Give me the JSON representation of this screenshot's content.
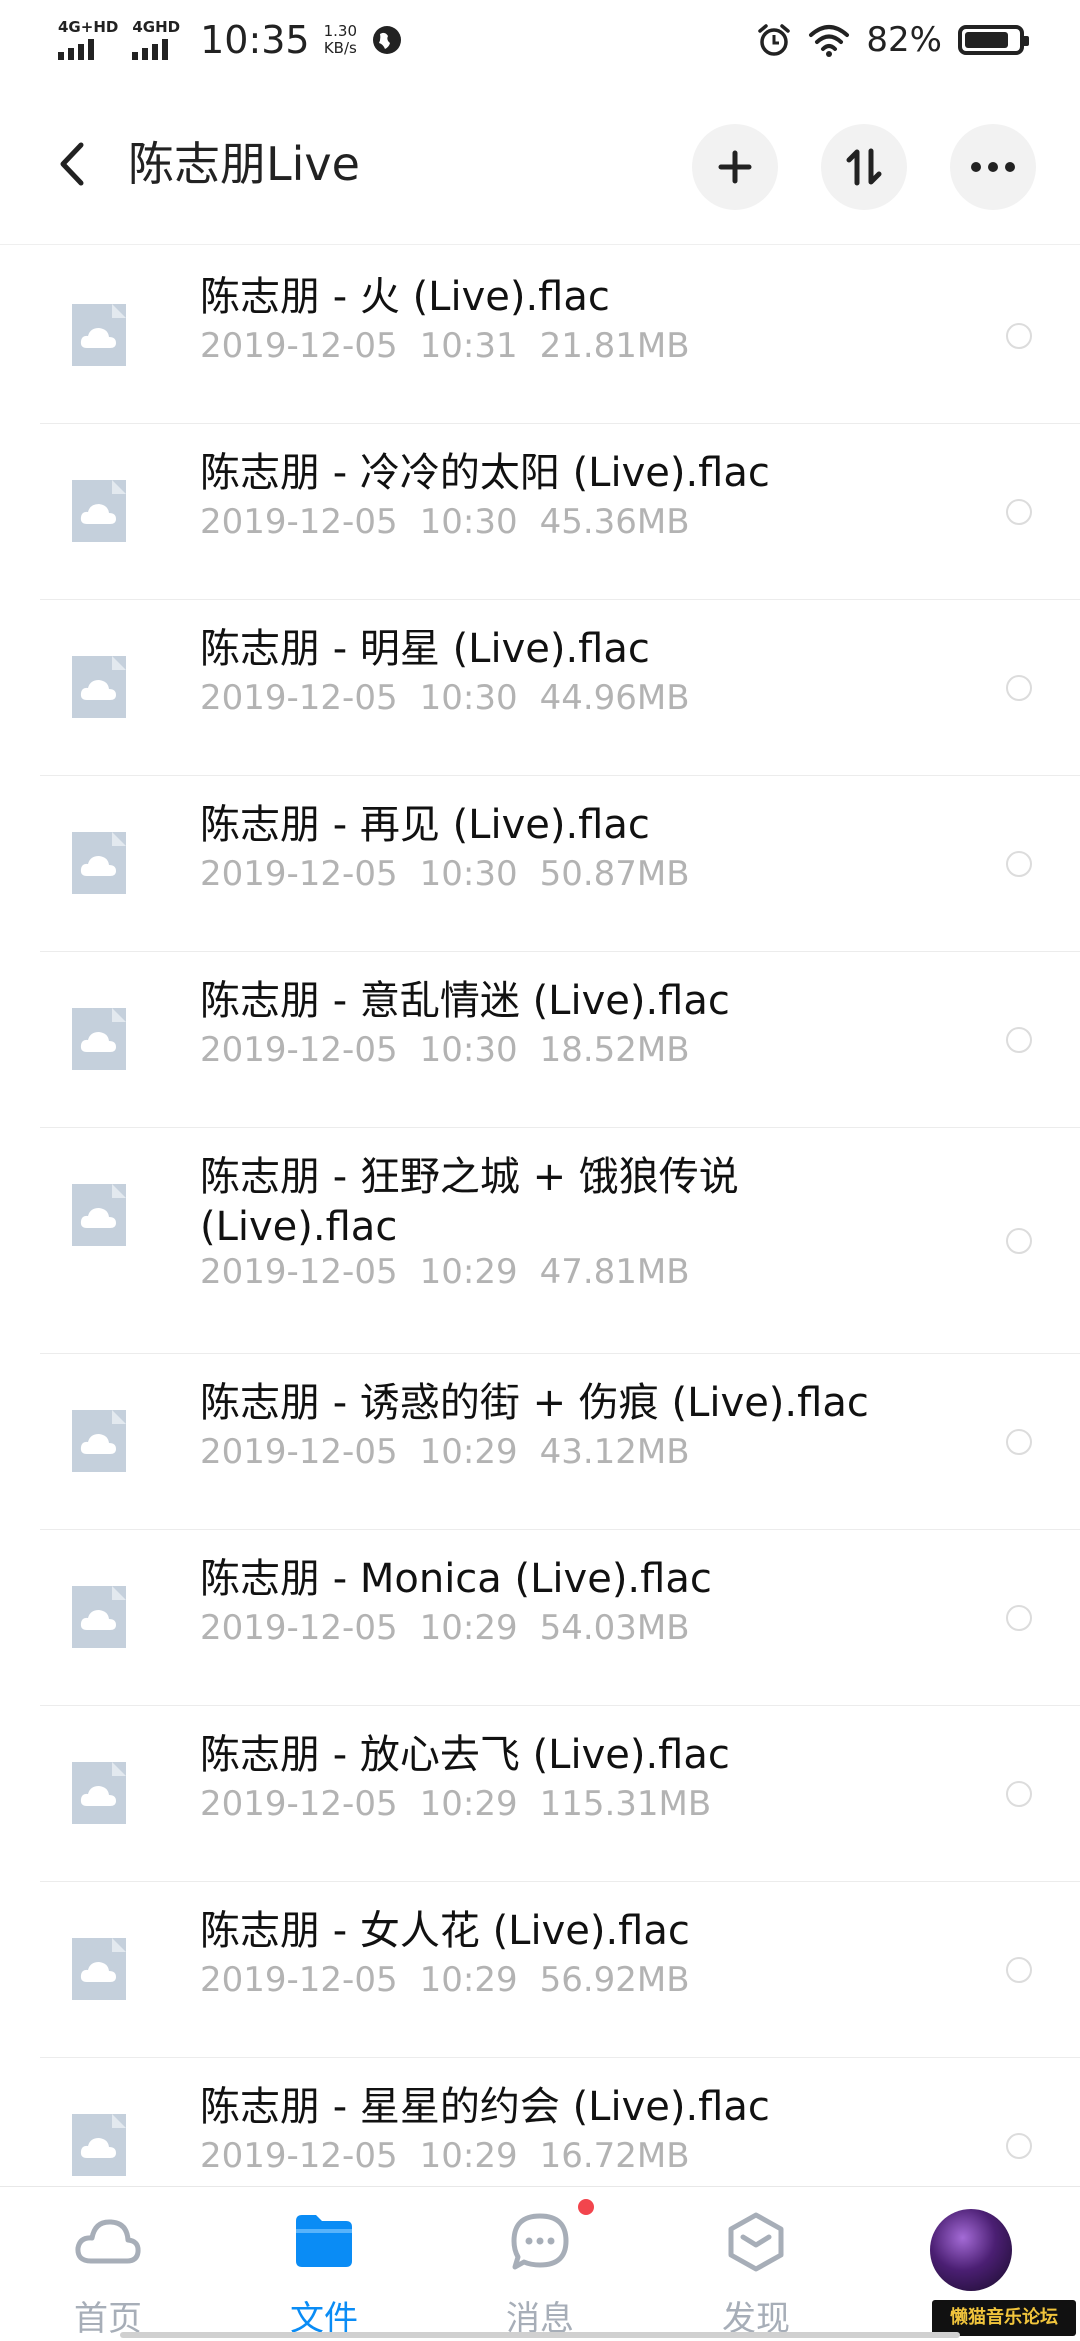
{
  "status_bar": {
    "signal1_label": "4G+HD",
    "signal2_label": "4GHD",
    "time": "10:35",
    "speed_value": "1.30",
    "speed_unit": "KB/s",
    "battery": "82%",
    "battery_level": 0.82
  },
  "header": {
    "title": "陈志朋Live",
    "add_icon": "plus-icon",
    "sort_icon": "sort-arrows-icon",
    "more_icon": "more-horizontal-icon"
  },
  "files": [
    {
      "name": "陈志朋 - 火 (Live).flac",
      "date": "2019-12-05",
      "time": "10:31",
      "size": "21.81MB"
    },
    {
      "name": "陈志朋 - 冷冷的太阳 (Live).flac",
      "date": "2019-12-05",
      "time": "10:30",
      "size": "45.36MB"
    },
    {
      "name": "陈志朋 - 明星 (Live).flac",
      "date": "2019-12-05",
      "time": "10:30",
      "size": "44.96MB"
    },
    {
      "name": "陈志朋 - 再见 (Live).flac",
      "date": "2019-12-05",
      "time": "10:30",
      "size": "50.87MB"
    },
    {
      "name": "陈志朋 - 意乱情迷 (Live).flac",
      "date": "2019-12-05",
      "time": "10:30",
      "size": "18.52MB"
    },
    {
      "name": "陈志朋 - 狂野之城 + 饿狼传说 (Live).flac",
      "date": "2019-12-05",
      "time": "10:29",
      "size": "47.81MB"
    },
    {
      "name": "陈志朋 - 诱惑的街 + 伤痕 (Live).flac",
      "date": "2019-12-05",
      "time": "10:29",
      "size": "43.12MB"
    },
    {
      "name": "陈志朋 - Monica (Live).flac",
      "date": "2019-12-05",
      "time": "10:29",
      "size": "54.03MB"
    },
    {
      "name": "陈志朋 - 放心去飞 (Live).flac",
      "date": "2019-12-05",
      "time": "10:29",
      "size": "115.31MB"
    },
    {
      "name": "陈志朋 - 女人花 (Live).flac",
      "date": "2019-12-05",
      "time": "10:29",
      "size": "56.92MB"
    },
    {
      "name": "陈志朋 - 星星的约会 (Live).flac",
      "date": "2019-12-05",
      "time": "10:29",
      "size": "16.72MB"
    }
  ],
  "tabs": [
    {
      "label": "首页",
      "icon": "cloud-icon",
      "active": false
    },
    {
      "label": "文件",
      "icon": "folder-icon",
      "active": true
    },
    {
      "label": "消息",
      "icon": "chat-icon",
      "active": false,
      "badge": true
    },
    {
      "label": "发现",
      "icon": "discover-icon",
      "active": false
    }
  ],
  "watermark": "懒猫音乐论坛",
  "colors": {
    "accent": "#0a8cf5",
    "file_icon": "#c5d0dc",
    "meta_text": "#b3b3b3",
    "badge": "#f2454d"
  }
}
